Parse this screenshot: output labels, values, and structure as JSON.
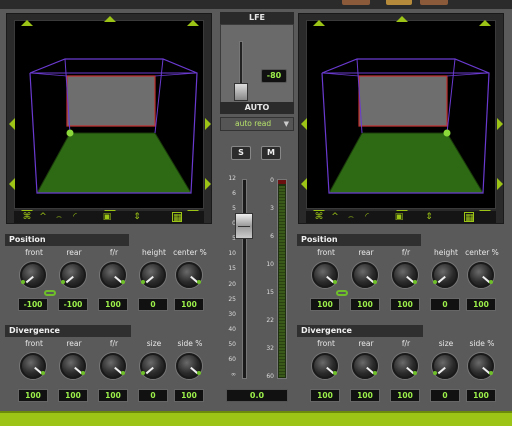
{
  "colors": {
    "accent": "#9cc416",
    "value_text": "#9cf04a",
    "panner_floor": "#2e6a14",
    "panner_ceiling": "#6a6a6a"
  },
  "center": {
    "lfe_label": "LFE",
    "lfe_value": "-80",
    "auto_label": "AUTO",
    "automation_mode": "auto read",
    "solo_label": "S",
    "mute_label": "M",
    "fader_scale": [
      "12",
      "6",
      "5",
      "0",
      "5",
      "10",
      "15",
      "20",
      "25",
      "30",
      "40",
      "50",
      "60",
      "∞"
    ],
    "meter_scale": [
      "0",
      "3",
      "6",
      "10",
      "15",
      "22",
      "32",
      "60"
    ],
    "volume_value": "0.0"
  },
  "left": {
    "position": {
      "title": "Position",
      "knobs": [
        {
          "label": "front",
          "value": "-100"
        },
        {
          "label": "rear",
          "value": "-100"
        },
        {
          "label": "f/r",
          "value": "100"
        },
        {
          "label": "height",
          "value": "0"
        },
        {
          "label": "center %",
          "value": "100"
        }
      ]
    },
    "divergence": {
      "title": "Divergence",
      "knobs": [
        {
          "label": "front",
          "value": "100"
        },
        {
          "label": "rear",
          "value": "100"
        },
        {
          "label": "f/r",
          "value": "100"
        },
        {
          "label": "size",
          "value": "0"
        },
        {
          "label": "side %",
          "value": "100"
        }
      ]
    }
  },
  "right": {
    "position": {
      "title": "Position",
      "knobs": [
        {
          "label": "front",
          "value": "100"
        },
        {
          "label": "rear",
          "value": "100"
        },
        {
          "label": "f/r",
          "value": "100"
        },
        {
          "label": "height",
          "value": "0"
        },
        {
          "label": "center %",
          "value": "100"
        }
      ]
    },
    "divergence": {
      "title": "Divergence",
      "knobs": [
        {
          "label": "front",
          "value": "100"
        },
        {
          "label": "rear",
          "value": "100"
        },
        {
          "label": "f/r",
          "value": "100"
        },
        {
          "label": "size",
          "value": "0"
        },
        {
          "label": "side %",
          "value": "100"
        }
      ]
    }
  },
  "toolbar_icons": [
    "pan-mode-icon",
    "curve-up-icon",
    "curve-down-icon",
    "curve-flat-icon",
    "speaker-icon",
    "grid-icon"
  ]
}
